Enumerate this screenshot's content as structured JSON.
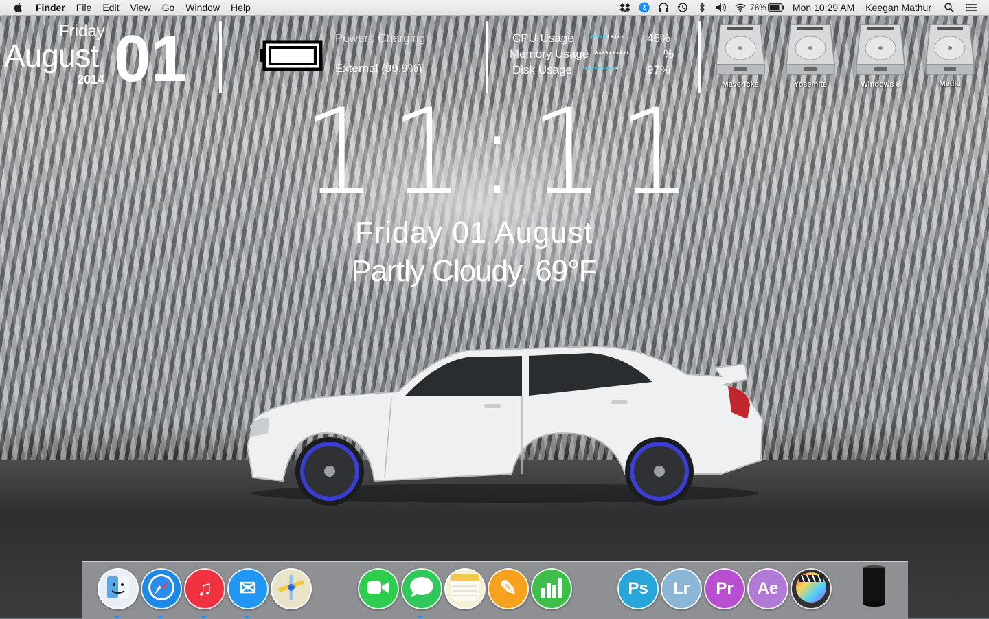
{
  "menubar": {
    "app_name": "Finder",
    "menus": [
      "File",
      "Edit",
      "View",
      "Go",
      "Window",
      "Help"
    ],
    "battery_percent": "76%",
    "clock": "Mon 10:29 AM",
    "user": "Keegan Mathur",
    "status_icons": [
      "dropbox-icon",
      "shazam-icon",
      "headphones-icon",
      "time-machine-icon",
      "bluetooth-icon",
      "volume-icon",
      "wifi-icon",
      "battery-icon",
      "spotlight-icon",
      "notification-center-icon"
    ]
  },
  "date_widget": {
    "day": "Friday",
    "month": "August",
    "year": "2014",
    "date": "01"
  },
  "power_widget": {
    "status": "Power : Charging",
    "source": "External (99.9%)",
    "level": 0.999
  },
  "usage_widget": {
    "rows": [
      {
        "label": "CPU Usage",
        "stars_on": "*****",
        "stars_off": "*****",
        "value": "46%"
      },
      {
        "label": "Memory Usage",
        "stars_on": "",
        "stars_off": "**********",
        "value": "%"
      },
      {
        "label": "Disk Usage",
        "stars_on": "*********",
        "stars_off": "*",
        "value": "97%"
      }
    ]
  },
  "drives": [
    {
      "label": "Mavericks"
    },
    {
      "label": "Yosemite"
    },
    {
      "label": "Windows 8"
    },
    {
      "label": "Media"
    }
  ],
  "clock_widget": {
    "time": "11:11",
    "date": "Friday 01 August",
    "weather": "Partly Cloudy, 69°F"
  },
  "dock": {
    "apps": [
      {
        "name": "Finder",
        "icon": "finder-icon",
        "text": "",
        "color": "#e8eef3",
        "running": true
      },
      {
        "name": "Safari",
        "icon": "safari-icon",
        "text": "",
        "color": "#1e88e5",
        "running": true
      },
      {
        "name": "iTunes",
        "icon": "itunes-icon",
        "text": "♫",
        "color": "#f0313f",
        "running": true
      },
      {
        "name": "Mail",
        "icon": "mail-icon",
        "text": "✉",
        "color": "#2196f3",
        "running": true
      },
      {
        "name": "Maps",
        "icon": "maps-icon",
        "text": "",
        "color": "#e9e4c8",
        "running": false
      },
      {
        "name": "FaceTime",
        "icon": "facetime-icon",
        "text": "",
        "color": "#2ecc4f",
        "running": false
      },
      {
        "name": "Messages",
        "icon": "messages-icon",
        "text": "",
        "color": "#30c85a",
        "running": true
      },
      {
        "name": "Notes",
        "icon": "notes-icon",
        "text": "",
        "color": "#f5f0d6",
        "running": false
      },
      {
        "name": "Pages",
        "icon": "pages-icon",
        "text": "✎",
        "color": "#f6a21e",
        "running": false
      },
      {
        "name": "Numbers",
        "icon": "numbers-icon",
        "text": "",
        "color": "#3fbf4a",
        "running": false
      },
      {
        "name": "Photoshop",
        "icon": "photoshop-icon",
        "text": "Ps",
        "color": "#29a6d9",
        "running": false
      },
      {
        "name": "Lightroom",
        "icon": "lightroom-icon",
        "text": "Lr",
        "color": "#8cb6d6",
        "running": false
      },
      {
        "name": "Premiere Pro",
        "icon": "premiere-icon",
        "text": "Pr",
        "color": "#b84fd1",
        "running": false
      },
      {
        "name": "After Effects",
        "icon": "after-effects-icon",
        "text": "Ae",
        "color": "#b07ad6",
        "running": false
      },
      {
        "name": "Final Cut Pro",
        "icon": "final-cut-icon",
        "text": "",
        "color": "#333333",
        "running": false
      },
      {
        "name": "Mac Pro",
        "icon": "mac-pro-icon",
        "text": "",
        "color": "#1b1b1b",
        "running": false
      }
    ]
  }
}
